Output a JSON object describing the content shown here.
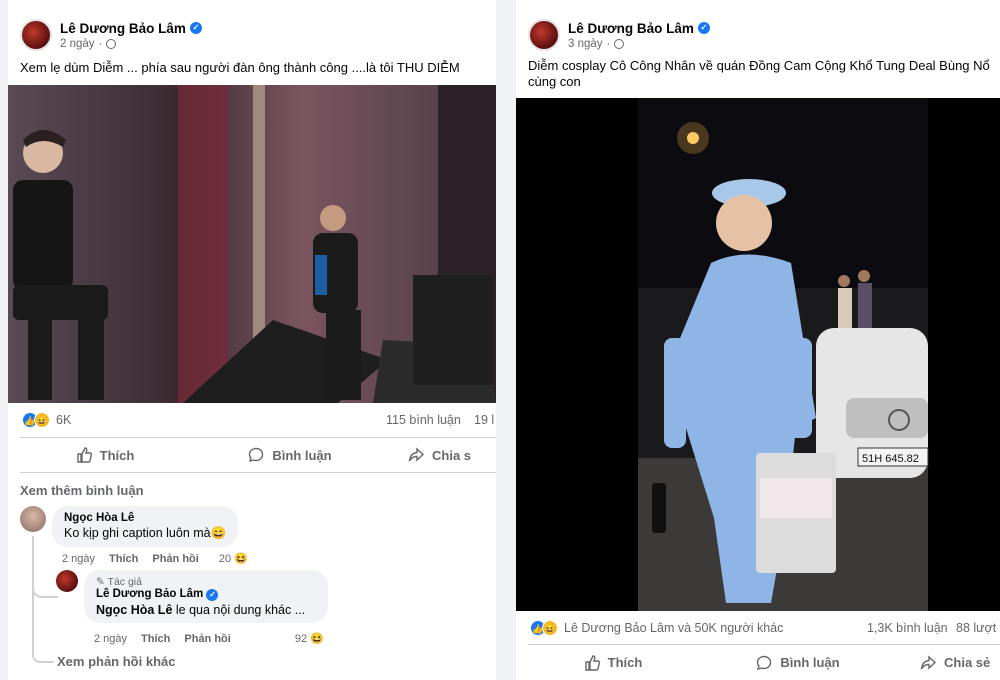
{
  "left_post": {
    "author": "Lê Dương Bảo Lâm",
    "time": "2 ngày",
    "caption": "Xem lẹ dùm Diễm ... phía sau người đàn ông thành công ....là tôi THU DIỄM",
    "reaction_count": "6K",
    "comment_count": "115 bình luận",
    "share_count": "19 l",
    "actions": {
      "like": "Thích",
      "comment": "Bình luận",
      "share": "Chia s"
    },
    "see_more_comments": "Xem thêm bình luận",
    "comment": {
      "author": "Ngọc Hòa Lê",
      "text": "Ko kịp ghi caption luôn mà😄",
      "time": "2 ngày",
      "like": "Thích",
      "reply": "Phản hồi",
      "reactions": "20"
    },
    "reply": {
      "tag": "Tác giả",
      "author": "Lê Dương Bảo Lâm",
      "mention": "Ngọc Hòa Lê",
      "text": "le qua nội dung khác ...",
      "time": "2 ngày",
      "like": "Thích",
      "reply": "Phản hồi",
      "reactions": "92"
    },
    "see_more_replies": "Xem phản hồi khác"
  },
  "right_post": {
    "author": "Lê Dương Bảo Lâm",
    "time": "3 ngày",
    "caption": "Diễm cosplay Cô Công Nhân về quán Đồng Cam Cộng Khổ Tung Deal Bùng Nổ cùng con",
    "plate_text": "51H 645.82",
    "reaction_text": "Lê Dương Bảo Lâm và 50K người khác",
    "comment_count": "1,3K bình luận",
    "share_count": "88 lượt",
    "actions": {
      "like": "Thích",
      "comment": "Bình luận",
      "share": "Chia sẻ"
    }
  },
  "colors": {
    "brand_blue": "#1877f2",
    "muted_text": "#65676b",
    "haha_yellow": "#f7b928"
  }
}
